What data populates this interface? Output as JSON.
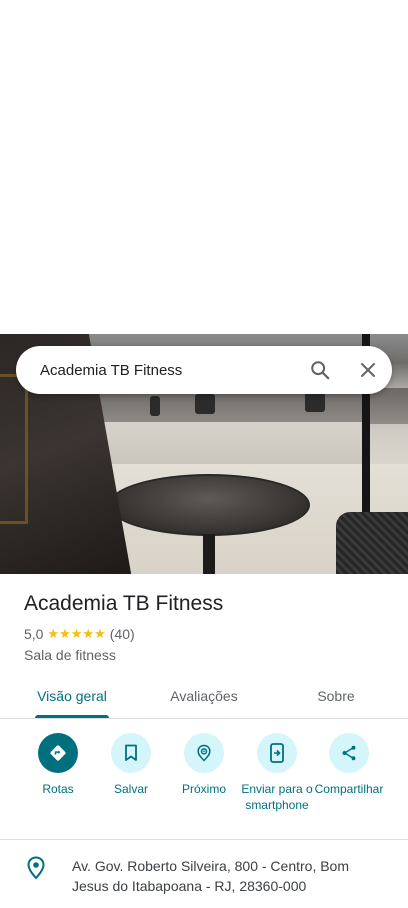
{
  "search": {
    "query": "Academia TB Fitness"
  },
  "place": {
    "name": "Academia TB Fitness",
    "rating": "5,0",
    "stars": "★★★★★",
    "review_count": "(40)",
    "category": "Sala de fitness"
  },
  "tabs": [
    {
      "label": "Visão geral",
      "active": true
    },
    {
      "label": "Avaliações",
      "active": false
    },
    {
      "label": "Sobre",
      "active": false
    }
  ],
  "actions": [
    {
      "label": "Rotas",
      "icon": "directions-icon"
    },
    {
      "label": "Salvar",
      "icon": "bookmark-icon"
    },
    {
      "label": "Próximo",
      "icon": "nearby-icon"
    },
    {
      "label": "Enviar para o smartphone",
      "icon": "send-to-phone-icon"
    },
    {
      "label": "Compartilhar",
      "icon": "share-icon"
    }
  ],
  "address": {
    "text": "Av. Gov. Roberto Silveira, 800 - Centro, Bom Jesus do Itabapoana - RJ, 28360-000"
  },
  "colors": {
    "accent": "#00707f",
    "action_bg": "#d4f5fa",
    "star": "#fbbc04"
  }
}
